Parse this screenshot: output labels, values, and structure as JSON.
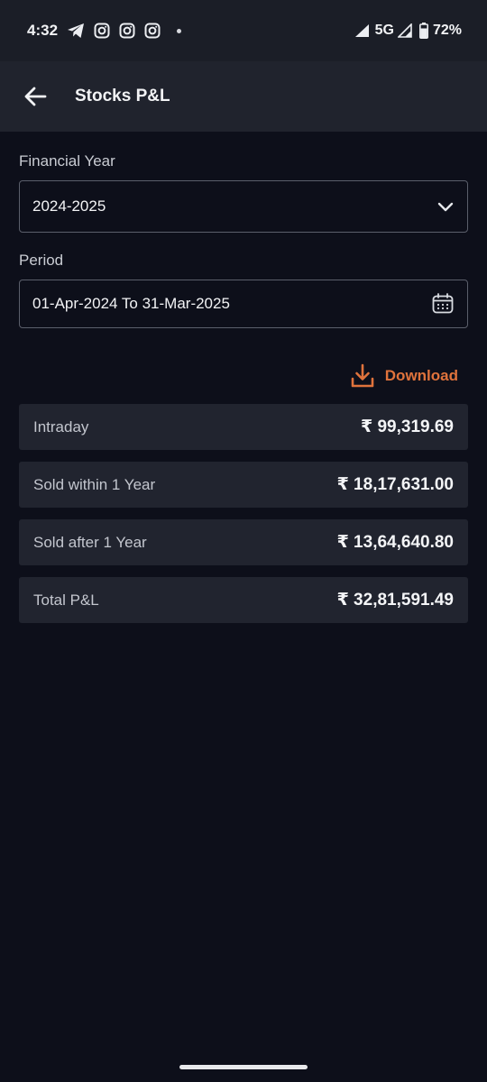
{
  "status_bar": {
    "time": "4:32",
    "network": "5G",
    "battery": "72%",
    "icons": [
      "telegram-icon",
      "instagram-icon",
      "instagram-icon",
      "instagram-icon",
      "notification-dot",
      "signal-icon",
      "signal-icon",
      "battery-icon"
    ]
  },
  "app_bar": {
    "title": "Stocks P&L",
    "back_icon": "arrow-left-icon"
  },
  "form": {
    "financial_year_label": "Financial Year",
    "financial_year_value": "2024-2025",
    "period_label": "Period",
    "period_value": "01-Apr-2024 To 31-Mar-2025"
  },
  "download": {
    "label": "Download",
    "color": "#e0733c"
  },
  "summary": [
    {
      "label": "Intraday",
      "value": "₹ 99,319.69"
    },
    {
      "label": "Sold within 1 Year",
      "value": "₹ 18,17,631.00"
    },
    {
      "label": "Sold after 1 Year",
      "value": "₹ 13,64,640.80"
    },
    {
      "label": "Total P&L",
      "value": "₹ 32,81,591.49"
    }
  ],
  "colors": {
    "background": "#0d0f1a",
    "app_bar": "#20232d",
    "row": "#21242f",
    "accent": "#e0733c"
  }
}
